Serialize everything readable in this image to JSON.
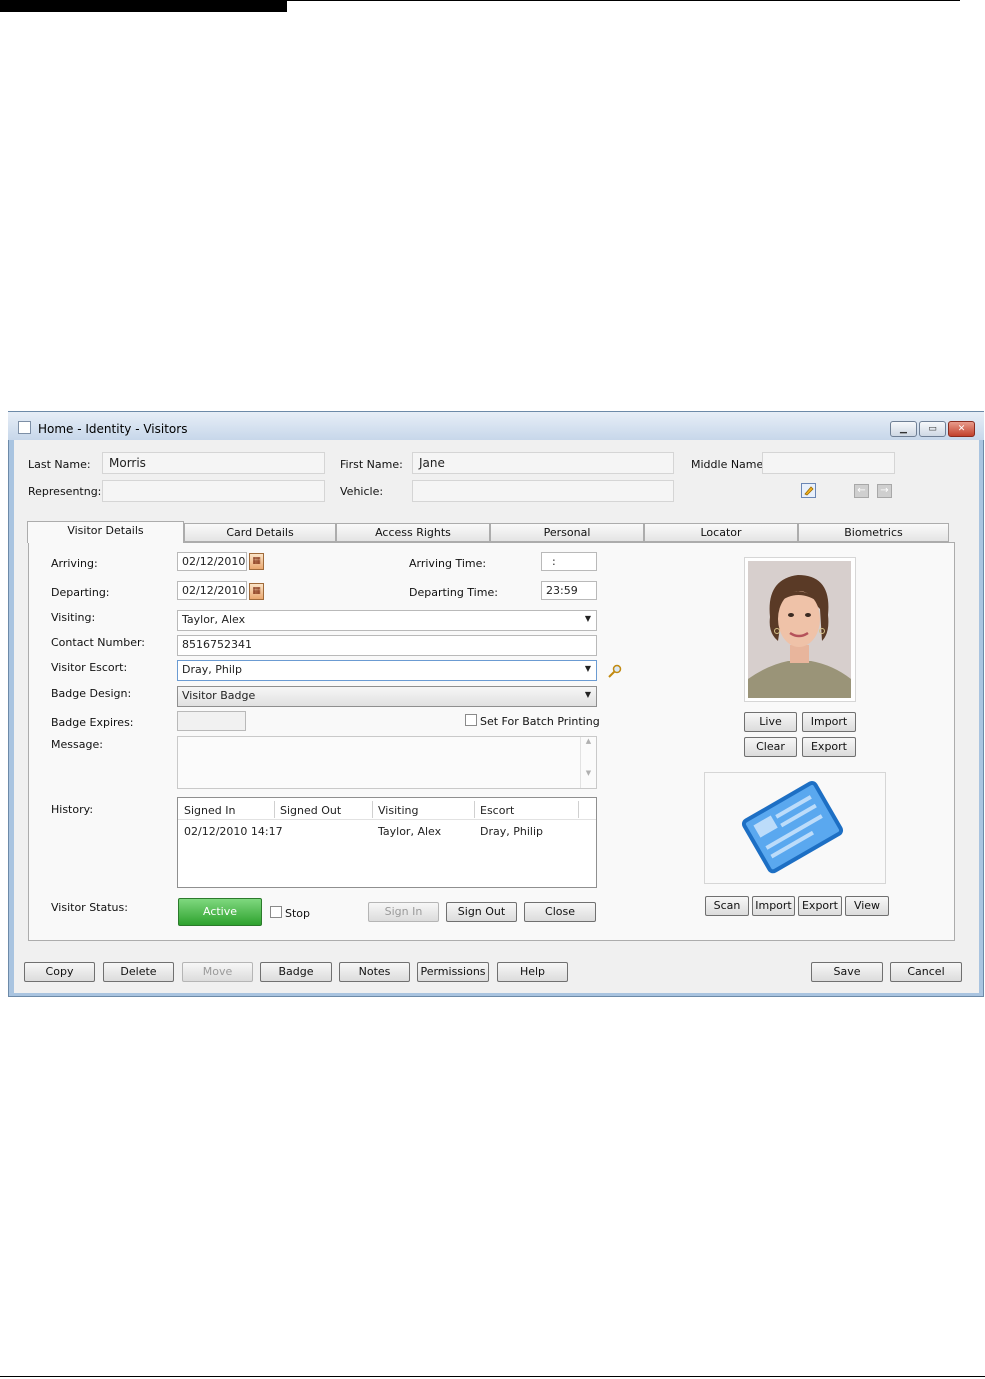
{
  "window": {
    "title": "Home - Identity - Visitors"
  },
  "header": {
    "last_name_label": "Last Name:",
    "last_name": "Morris",
    "first_name_label": "First Name:",
    "first_name": "Jane",
    "middle_name_label": "Middle Name:",
    "middle_name": "",
    "representing_label": "Representng:",
    "representing": "",
    "vehicle_label": "Vehicle:",
    "vehicle": ""
  },
  "tabs": [
    {
      "label": "Visitor Details",
      "active": true
    },
    {
      "label": "Card Details"
    },
    {
      "label": "Access Rights"
    },
    {
      "label": "Personal"
    },
    {
      "label": "Locator"
    },
    {
      "label": "Biometrics"
    }
  ],
  "details": {
    "arriving_label": "Arriving:",
    "arriving": "02/12/2010",
    "departing_label": "Departing:",
    "departing": "02/12/2010",
    "arriving_time_label": "Arriving Time:",
    "arriving_time": ":",
    "departing_time_label": "Departing Time:",
    "departing_time": "23:59",
    "visiting_label": "Visiting:",
    "visiting": "Taylor, Alex",
    "contact_label": "Contact Number:",
    "contact": "8516752341",
    "escort_label": "Visitor Escort:",
    "escort": "Dray, Philp",
    "badge_design_label": "Badge Design:",
    "badge_design": "Visitor Badge",
    "badge_expires_label": "Badge Expires:",
    "badge_expires": "",
    "batch_label": "Set For Batch Printing",
    "message_label": "Message:",
    "history_label": "History:",
    "status_label": "Visitor Status:",
    "status_value": "Active",
    "stop_label": "Stop",
    "sign_in": "Sign In",
    "sign_out": "Sign Out",
    "close": "Close"
  },
  "history": {
    "columns": [
      "Signed In",
      "Signed Out",
      "Visiting",
      "Escort"
    ],
    "rows": [
      {
        "signed_in": "02/12/2010 14:17",
        "signed_out": "",
        "visiting": "Taylor, Alex",
        "escort": "Dray, Philip"
      }
    ]
  },
  "photo_buttons": {
    "live": "Live",
    "import": "Import",
    "clear": "Clear",
    "export": "Export"
  },
  "card_buttons": {
    "scan": "Scan",
    "import": "Import",
    "export": "Export",
    "view": "View"
  },
  "footer": {
    "copy": "Copy",
    "delete": "Delete",
    "move": "Move",
    "badge": "Badge",
    "notes": "Notes",
    "permissions": "Permissions",
    "help": "Help",
    "save": "Save",
    "cancel": "Cancel"
  },
  "colors": {
    "title_gradient_top": "#e7eef7",
    "active_status": "#2ea22e",
    "card_blue": "#3b8fde"
  },
  "icons": [
    "app-icon",
    "minimize-icon",
    "maximize-icon",
    "close-icon",
    "calendar-icon",
    "edit-note-icon",
    "back-arrow-icon",
    "forward-arrow-icon",
    "search-icon",
    "id-card-icon"
  ]
}
